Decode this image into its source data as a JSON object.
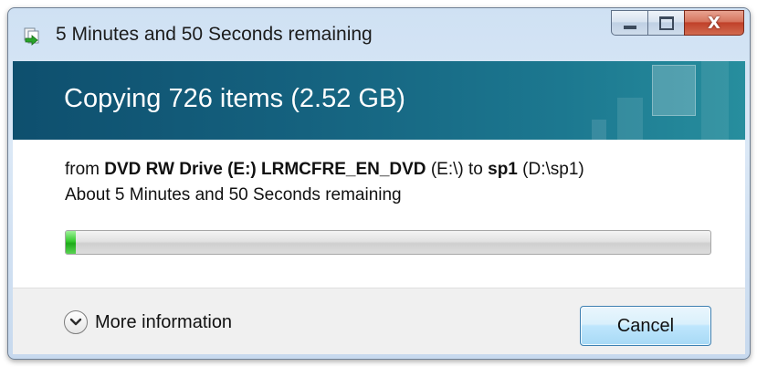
{
  "window": {
    "title": "5 Minutes and 50 Seconds remaining",
    "icon": "copy-files-icon",
    "close_glyph": "X"
  },
  "header": {
    "title": "Copying 726 items (2.52 GB)"
  },
  "details": {
    "from_prefix": "from",
    "source_name": "DVD RW Drive (E:) LRMCFRE_EN_DVD",
    "source_path": "(E:\\)",
    "to_word": "to",
    "dest_name": "sp1",
    "dest_path": "(D:\\sp1)",
    "time_remaining": "About 5 Minutes and 50 Seconds remaining"
  },
  "progress": {
    "fraction": 0.015,
    "color": "#36c92f"
  },
  "footer": {
    "more_info_label": "More information",
    "more_info_icon": "chevron-down-icon",
    "cancel_label": "Cancel"
  },
  "colors": {
    "header_band": "#15627f",
    "accent_button": "#3c7fb1"
  }
}
